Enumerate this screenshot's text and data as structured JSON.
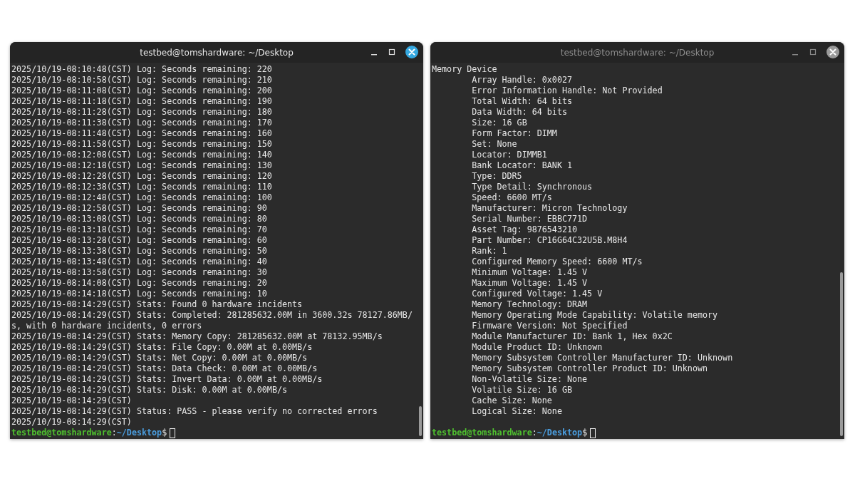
{
  "windows": [
    {
      "title": "testbed@tomshardware: ~/Desktop",
      "focused": true,
      "kind": "log",
      "lines": [
        "2025/10/19-08:10:48(CST) Log: Seconds remaining: 220",
        "2025/10/19-08:10:58(CST) Log: Seconds remaining: 210",
        "2025/10/19-08:11:08(CST) Log: Seconds remaining: 200",
        "2025/10/19-08:11:18(CST) Log: Seconds remaining: 190",
        "2025/10/19-08:11:28(CST) Log: Seconds remaining: 180",
        "2025/10/19-08:11:38(CST) Log: Seconds remaining: 170",
        "2025/10/19-08:11:48(CST) Log: Seconds remaining: 160",
        "2025/10/19-08:11:58(CST) Log: Seconds remaining: 150",
        "2025/10/19-08:12:08(CST) Log: Seconds remaining: 140",
        "2025/10/19-08:12:18(CST) Log: Seconds remaining: 130",
        "2025/10/19-08:12:28(CST) Log: Seconds remaining: 120",
        "2025/10/19-08:12:38(CST) Log: Seconds remaining: 110",
        "2025/10/19-08:12:48(CST) Log: Seconds remaining: 100",
        "2025/10/19-08:12:58(CST) Log: Seconds remaining: 90",
        "2025/10/19-08:13:08(CST) Log: Seconds remaining: 80",
        "2025/10/19-08:13:18(CST) Log: Seconds remaining: 70",
        "2025/10/19-08:13:28(CST) Log: Seconds remaining: 60",
        "2025/10/19-08:13:38(CST) Log: Seconds remaining: 50",
        "2025/10/19-08:13:48(CST) Log: Seconds remaining: 40",
        "2025/10/19-08:13:58(CST) Log: Seconds remaining: 30",
        "2025/10/19-08:14:08(CST) Log: Seconds remaining: 20",
        "2025/10/19-08:14:18(CST) Log: Seconds remaining: 10",
        "2025/10/19-08:14:29(CST) Stats: Found 0 hardware incidents",
        "2025/10/19-08:14:29(CST) Stats: Completed: 281285632.00M in 3600.32s 78127.86MB/s, with 0 hardware incidents, 0 errors",
        "2025/10/19-08:14:29(CST) Stats: Memory Copy: 281285632.00M at 78132.95MB/s",
        "2025/10/19-08:14:29(CST) Stats: File Copy: 0.00M at 0.00MB/s",
        "2025/10/19-08:14:29(CST) Stats: Net Copy: 0.00M at 0.00MB/s",
        "2025/10/19-08:14:29(CST) Stats: Data Check: 0.00M at 0.00MB/s",
        "2025/10/19-08:14:29(CST) Stats: Invert Data: 0.00M at 0.00MB/s",
        "2025/10/19-08:14:29(CST) Stats: Disk: 0.00M at 0.00MB/s",
        "2025/10/19-08:14:29(CST)",
        "2025/10/19-08:14:29(CST) Status: PASS - please verify no corrected errors",
        "2025/10/19-08:14:29(CST)"
      ],
      "prompt": {
        "user_host": "testbed@tomshardware",
        "separator": ":",
        "path": "~/Desktop",
        "symbol": "$"
      }
    },
    {
      "title": "testbed@tomshardware: ~/Desktop",
      "focused": false,
      "kind": "record",
      "heading": "Memory Device",
      "fields": [
        "Array Handle: 0x0027",
        "Error Information Handle: Not Provided",
        "Total Width: 64 bits",
        "Data Width: 64 bits",
        "Size: 16 GB",
        "Form Factor: DIMM",
        "Set: None",
        "Locator: DIMMB1",
        "Bank Locator: BANK 1",
        "Type: DDR5",
        "Type Detail: Synchronous",
        "Speed: 6600 MT/s",
        "Manufacturer: Micron Technology",
        "Serial Number: EBBC771D",
        "Asset Tag: 9876543210",
        "Part Number: CP16G64C32U5B.M8H4",
        "Rank: 1",
        "Configured Memory Speed: 6600 MT/s",
        "Minimum Voltage: 1.45 V",
        "Maximum Voltage: 1.45 V",
        "Configured Voltage: 1.45 V",
        "Memory Technology: DRAM",
        "Memory Operating Mode Capability: Volatile memory",
        "Firmware Version: Not Specified",
        "Module Manufacturer ID: Bank 1, Hex 0x2C",
        "Module Product ID: Unknown",
        "Memory Subsystem Controller Manufacturer ID: Unknown",
        "Memory Subsystem Controller Product ID: Unknown",
        "Non-Volatile Size: None",
        "Volatile Size: 16 GB",
        "Cache Size: None",
        "Logical Size: None"
      ],
      "prompt": {
        "user_host": "testbed@tomshardware",
        "separator": ":",
        "path": "~/Desktop",
        "symbol": "$"
      }
    }
  ]
}
